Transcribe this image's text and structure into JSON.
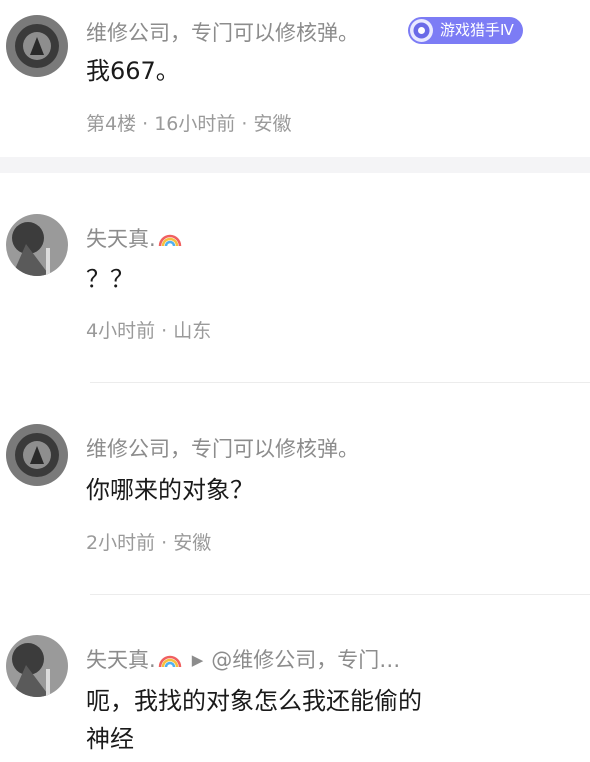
{
  "comments": [
    {
      "name": "维修公司，专门可以修核弹。",
      "badge": "游戏猎手Ⅳ",
      "content": "我667。",
      "meta": "第4楼 · 16小时前 · 安徽",
      "avatar_color": "#5a5a5a"
    },
    {
      "name": "失天真.",
      "content": "？？",
      "meta": "4小时前 · 山东",
      "avatar_color": "#6a6a6a"
    },
    {
      "name": "维修公司，专门可以修核弹。",
      "content": "你哪来的对象？",
      "meta": "2小时前 · 安徽",
      "avatar_color": "#5a5a5a"
    },
    {
      "name": "失天真.",
      "reply_to": "@维修公司，专门…",
      "content_line1": "呃，我找的对象怎么我还能偷的",
      "content_line2": "神经",
      "avatar_color": "#6a6a6a"
    }
  ],
  "colors": {
    "name": "#8c8c8c",
    "badge_bg": "#7c7cf5",
    "meta": "#9a9a9a",
    "separator": "#f4f4f6"
  },
  "icons": [
    "rainbow-icon",
    "play-arrow-icon",
    "game-hunter-badge-icon"
  ]
}
